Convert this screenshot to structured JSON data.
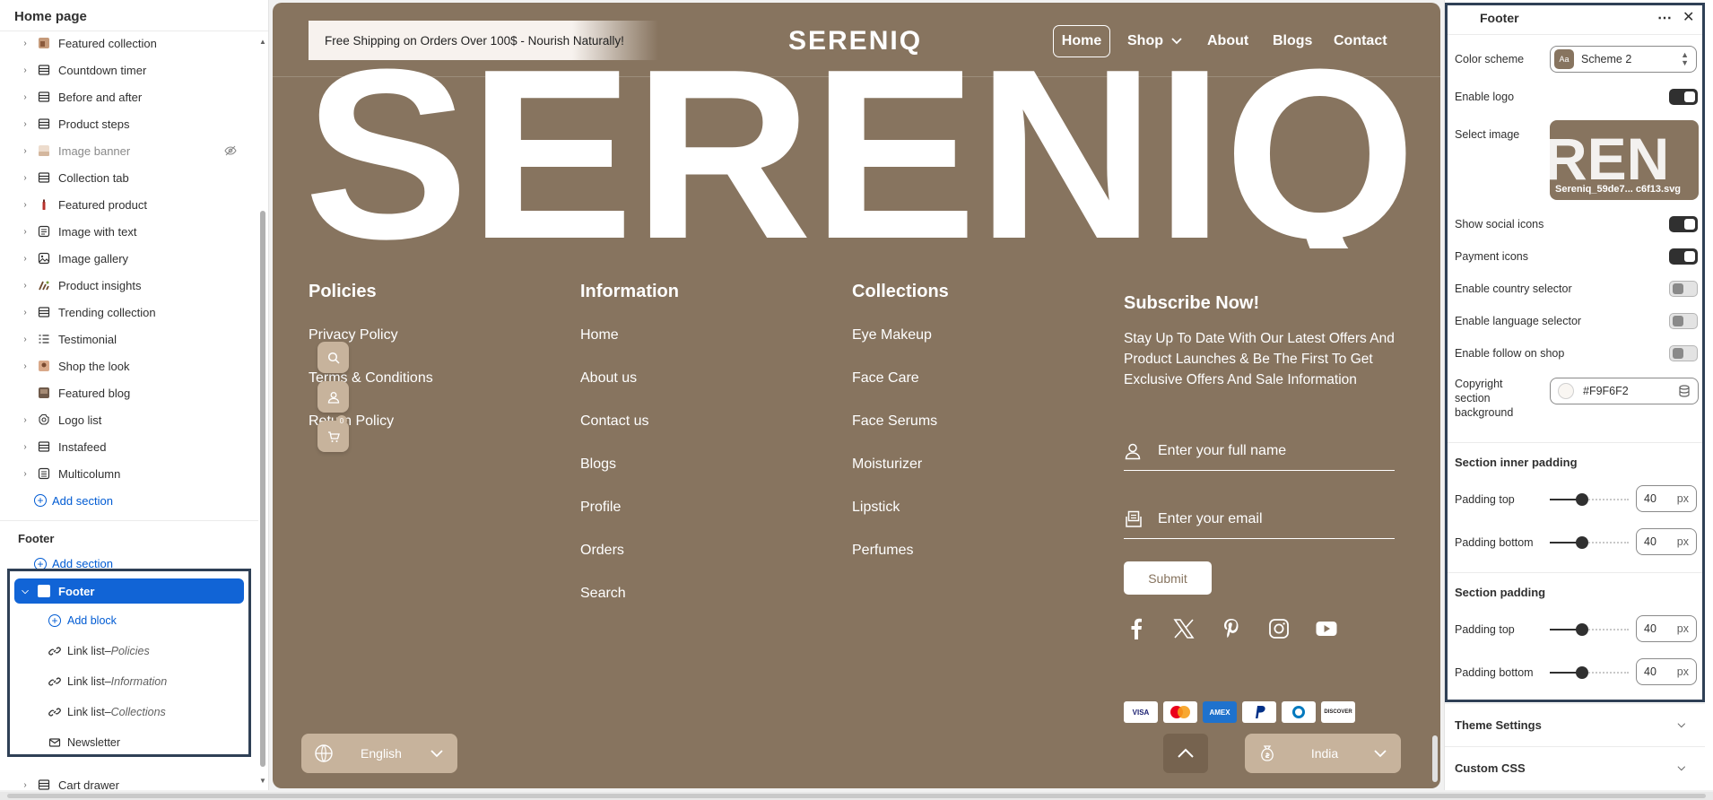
{
  "left_panel": {
    "title": "Home page",
    "sections": [
      {
        "label": "Featured collection",
        "icon": "featured-collection-thumb-icon"
      },
      {
        "label": "Countdown timer",
        "icon": "section-layout-icon"
      },
      {
        "label": "Before and after",
        "icon": "section-layout-icon"
      },
      {
        "label": "Product steps",
        "icon": "section-layout-icon"
      },
      {
        "label": "Image banner",
        "icon": "image-banner-thumb-icon",
        "hidden": true
      },
      {
        "label": "Collection tab",
        "icon": "section-layout-icon"
      },
      {
        "label": "Featured product",
        "icon": "featured-product-thumb-icon"
      },
      {
        "label": "Image with text",
        "icon": "image-with-text-icon"
      },
      {
        "label": "Image gallery",
        "icon": "image-gallery-icon"
      },
      {
        "label": "Product insights",
        "icon": "product-insights-thumb-icon"
      },
      {
        "label": "Trending collection",
        "icon": "section-layout-icon"
      },
      {
        "label": "Testimonial",
        "icon": "testimonial-list-icon"
      },
      {
        "label": "Shop the look",
        "icon": "shop-the-look-thumb-icon"
      },
      {
        "label": "Featured blog",
        "icon": "featured-blog-thumb-icon"
      },
      {
        "label": "Logo list",
        "icon": "logo-list-icon"
      },
      {
        "label": "Instafeed",
        "icon": "section-layout-icon"
      },
      {
        "label": "Multicolumn",
        "icon": "multicolumn-icon"
      }
    ],
    "add_section": "Add section",
    "footer_group_label": "Footer",
    "footer_add_section": "Add section",
    "footer_section": "Footer",
    "add_block": "Add block",
    "blocks": [
      {
        "label": "Link list",
        "sep": " – ",
        "sub": "Policies"
      },
      {
        "label": "Link list",
        "sep": " – ",
        "sub": "Information"
      },
      {
        "label": "Link list",
        "sep": " – ",
        "sub": "Collections"
      },
      {
        "label": "Newsletter",
        "sep": "",
        "sub": ""
      }
    ],
    "cart_drawer": "Cart drawer"
  },
  "preview": {
    "promo_text": "Free Shipping on Orders Over 100$ - Nourish Naturally!",
    "brand": "SERENIQ",
    "nav": [
      "Home",
      "Shop",
      "About",
      "Blogs",
      "Contact"
    ],
    "big_logo_text": "SERENIQ",
    "policies": {
      "title": "Policies",
      "links": [
        "Privacy Policy",
        "Terms & Conditions",
        "Return Policy"
      ]
    },
    "information": {
      "title": "Information",
      "links": [
        "Home",
        "About us",
        "Contact us",
        "Blogs",
        "Profile",
        "Orders",
        "Search"
      ]
    },
    "collections": {
      "title": "Collections",
      "links": [
        "Eye Makeup",
        "Face Care",
        "Face Serums",
        "Moisturizer",
        "Lipstick",
        "Perfumes"
      ]
    },
    "subscribe": {
      "title": "Subscribe Now!",
      "text": "Stay Up To Date With Our Latest Offers And Product Launches & Be The First To Get Exclusive Offers And Sale Information",
      "name_placeholder": "Enter your full name",
      "email_placeholder": "Enter your email",
      "submit": "Submit"
    },
    "social_icons": [
      "facebook-icon",
      "x-icon",
      "pinterest-icon",
      "instagram-icon",
      "youtube-icon"
    ],
    "payment_icons": [
      "VISA",
      "MC",
      "AMEX",
      "PayPal",
      "Diners",
      "DISCOVER"
    ],
    "cart_count": "0",
    "language": "English",
    "country": "India"
  },
  "right_panel": {
    "title": "Footer",
    "color_scheme_label": "Color scheme",
    "color_scheme_swatch": "Aa",
    "color_scheme_value": "Scheme 2",
    "enable_logo_label": "Enable logo",
    "enable_logo": true,
    "select_image_label": "Select image",
    "image_filename": "Sereniq_59de7... c6f13.svg",
    "show_social_label": "Show social icons",
    "show_social": true,
    "payment_icons_label": "Payment icons",
    "payment_icons": true,
    "country_label": "Enable country selector",
    "country": false,
    "language_label": "Enable language selector",
    "language": false,
    "follow_label": "Enable follow on shop",
    "follow": false,
    "copyright_label_1": "Copyright",
    "copyright_label_2": "section",
    "copyright_label_3": "background",
    "copyright_color": "#F9F6F2",
    "inner_padding_heading": "Section inner padding",
    "section_padding_heading": "Section padding",
    "padding_top_label": "Padding top",
    "padding_bottom_label": "Padding bottom",
    "inner_padding_top": "40",
    "inner_padding_bottom": "40",
    "section_padding_top": "40",
    "section_padding_bottom": "40",
    "unit": "px",
    "theme_settings": "Theme Settings",
    "custom_css": "Custom CSS"
  },
  "colors": {
    "preview_bg": "#87745f",
    "accent": "#005bd3",
    "selected": "#1164d6",
    "highlight_border": "#2f4056"
  }
}
